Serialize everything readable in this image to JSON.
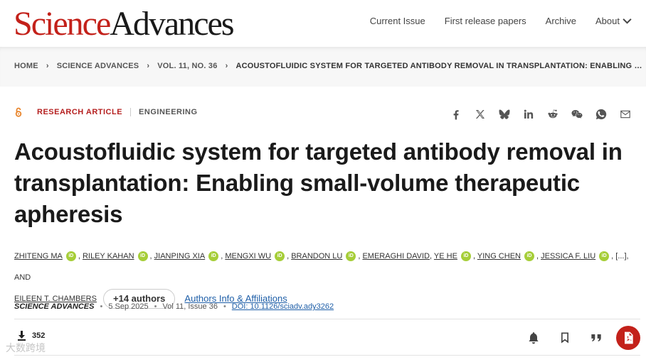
{
  "logo": {
    "science": "Science",
    "advances": "Advances"
  },
  "nav": {
    "current_issue": "Current Issue",
    "first_release": "First release papers",
    "archive": "Archive",
    "about": "About"
  },
  "breadcrumb": [
    "HOME",
    "SCIENCE ADVANCES",
    "VOL. 11, NO. 36",
    "ACOUSTOFLUIDIC SYSTEM FOR TARGETED ANTIBODY REMOVAL IN TRANSPLANTATION: ENABLING SMALL-VOLUME THERAPEUTIC APHERESIS"
  ],
  "article": {
    "type": "RESEARCH ARTICLE",
    "subject": "ENGINEERING",
    "title": "Acoustofluidic system for targeted antibody removal in transplantation: Enabling small-volume therapeutic apheresis"
  },
  "share_icons": [
    "facebook-icon",
    "x-icon",
    "bluesky-icon",
    "linkedin-icon",
    "reddit-icon",
    "wechat-icon",
    "whatsapp-icon",
    "email-icon"
  ],
  "authors": [
    "ZHITENG MA",
    "RILEY KAHAN",
    "JIANPING XIA",
    "MENGXI WU",
    "BRANDON LU",
    "EMERAGHI DAVID",
    "YE HE",
    "YING CHEN",
    "JESSICA F. LIU",
    "EILEEN T. CHAMBERS"
  ],
  "authors_ellipsis": "[...]",
  "authors_and": ", AND",
  "more_authors": "+14 authors",
  "affiliations_link": "Authors Info & Affiliations",
  "meta": {
    "journal": "SCIENCE ADVANCES",
    "date": "5 Sep 2025",
    "volume": "Vol 11, Issue 36",
    "doi": "DOI: 10.1126/sciadv.ady3262"
  },
  "downloads": "352",
  "watermark": "大数跨境",
  "colors": {
    "brand_red": "#c3211a",
    "link_blue": "#1f5fa8",
    "orcid_green": "#a6ce39"
  }
}
